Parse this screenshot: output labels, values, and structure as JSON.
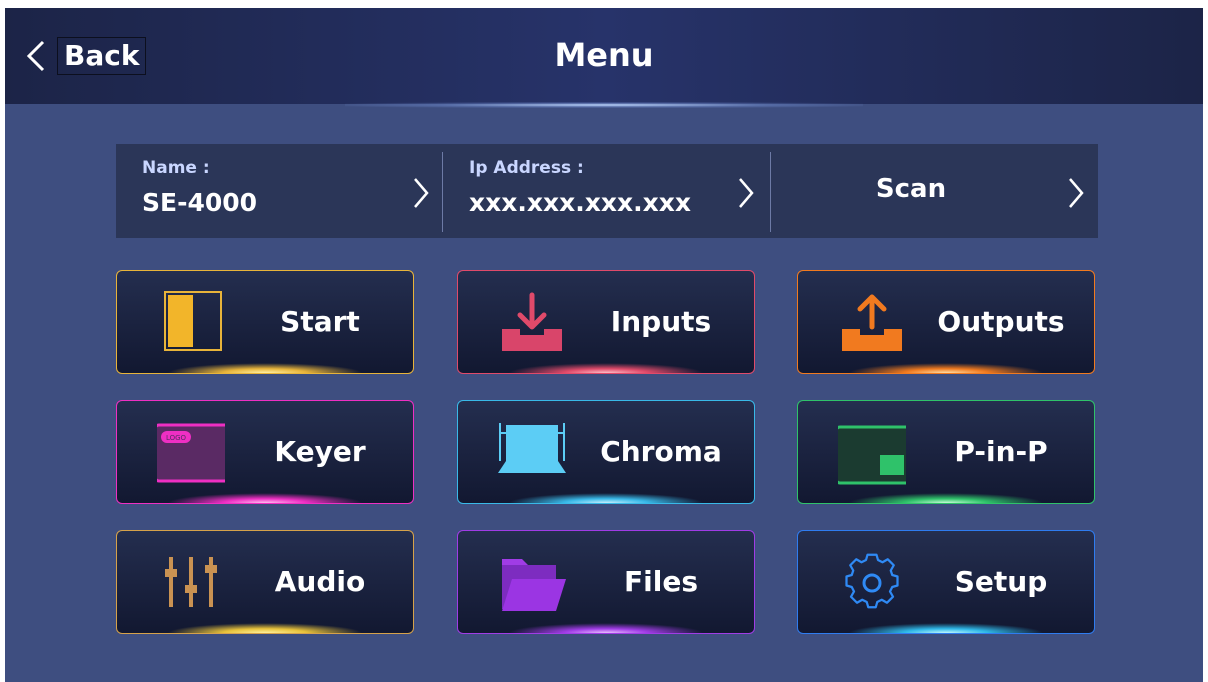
{
  "header": {
    "back_label": "Back",
    "title": "Menu"
  },
  "infobar": {
    "name_label": "Name :",
    "name_value": "SE-4000",
    "ip_label": "Ip Address :",
    "ip_value": "xxx.xxx.xxx.xxx",
    "scan_label": "Scan"
  },
  "tiles": [
    {
      "label": "Start",
      "icon": "split-screen-icon",
      "color": "#e8b43a"
    },
    {
      "label": "Inputs",
      "icon": "download-tray-icon",
      "color": "#e04a6a"
    },
    {
      "label": "Outputs",
      "icon": "upload-tray-icon",
      "color": "#f17a1f"
    },
    {
      "label": "Keyer",
      "icon": "logo-keyer-icon",
      "color": "#ee2fc3"
    },
    {
      "label": "Chroma",
      "icon": "green-screen-icon",
      "color": "#39b9e8"
    },
    {
      "label": "P-in-P",
      "icon": "picture-in-picture-icon",
      "color": "#2fc26a"
    },
    {
      "label": "Audio",
      "icon": "mixer-sliders-icon",
      "color": "#d6a24a"
    },
    {
      "label": "Files",
      "icon": "folder-icon",
      "color": "#a03ce6"
    },
    {
      "label": "Setup",
      "icon": "gear-icon",
      "color": "#2f7cf0"
    }
  ],
  "icon_text": {
    "logo_tag": "LOGO"
  }
}
